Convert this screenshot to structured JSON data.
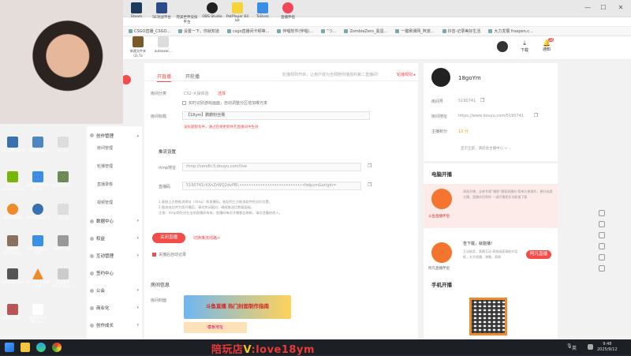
{
  "window": {
    "minimize_glyph": "—",
    "maximize_glyph": "☐",
    "close_glyph": "✕"
  },
  "desktop_top": [
    {
      "label": "Steam"
    },
    {
      "label": "5E对战平台"
    },
    {
      "label": "完美世界竞技平台"
    },
    {
      "label": "OBS Studio"
    },
    {
      "label": "PotPlayer 64 bit"
    },
    {
      "label": "ToDesk"
    },
    {
      "label": "直播伴侣"
    }
  ],
  "bookmarks": [
    "CSGO直播_CSGO...",
    "设置一下，你就知道",
    "csgo直播间卡顿等...",
    "伴唱软件(伴唱)...",
    "”つ...",
    "ZombieZero_黑蛋...",
    "一键刷课网_阿波...",
    "抖音-记录美好生活",
    "大力发展 fraspen.c..."
  ],
  "header": {
    "download_label": "下载",
    "notify_label": "通知",
    "notify_badge": "38"
  },
  "sidebar": {
    "groups": [
      {
        "label": "创作管理",
        "items": [
          "房间管理",
          "轮播管理",
          "直播录像",
          "视频管理"
        ]
      },
      {
        "label": "数据中心",
        "items": []
      },
      {
        "label": "权益",
        "items": []
      },
      {
        "label": "互动管理",
        "items": []
      },
      {
        "label": "签约中心",
        "items": []
      },
      {
        "label": "公会",
        "items": []
      },
      {
        "label": "商业化",
        "items": []
      },
      {
        "label": "创作成长",
        "items": []
      }
    ]
  },
  "main": {
    "tabs": [
      "开直播",
      "开轮播"
    ],
    "notice_text": "轮播规则开启，让用户成为全网陪你播放的第二直播间!",
    "notice_link": "轮播规则 ▸",
    "category_label": "房间分类",
    "category_value": "CS2-大操体验",
    "category_link": "选择",
    "auto_switch_label": "实时识别游戏画面，自动调整分区增加曝光率",
    "title_label": "房间标题",
    "title_value": "【18ym】鹏鹏粉丝赛",
    "title_warning": "该标题暂有中，通过后将更新并在直播间中生效",
    "stream_section": "推流设置",
    "rtmp_label": "rtmp地址",
    "rtmp_value": "rtmp://sendtc3.douyu.com/live",
    "key_label": "直播码",
    "key_value": "5190741rXXnZrWQ2dvPBl.••••••••••••••••••••••••••••fwlpcm&origin=",
    "help_lines": [
      "1.复制上方数推流地址（rtmp）和直播码，粘贴到三方推流软件的对应位置。",
      "2.推流成功并为您开播后，请勿关闭窗口，确保推流后数据面板。",
      "注意：rtmp地址仅在当前直播间有效，直播码每次开播都会刷新，请勿泄露给他人。"
    ],
    "close_button": "关闭直播",
    "close_link": "切换推流线路>",
    "nosave_label": "关播后自动记录",
    "room_info_title": "房间信息",
    "cover_label": "房间封面",
    "cover_banner_text": "斗鱼直播 热门封面制作指南",
    "cover_sub_text": "模板地址"
  },
  "profile": {
    "name": "18goYm",
    "room_id_label": "房间号",
    "room_id": "5190741",
    "room_url_label": "房间地址",
    "room_url": "https://www.douyu.com/5190741",
    "points_label": "主播积分",
    "points": "12 分",
    "more_link": "显示全部，请前往主播中心 >"
  },
  "pc_stream": {
    "title": "电脑开播",
    "app1_name": "斗鱼直播伴侣",
    "app1_desc": "高效开播，全新专属“爆款”模版直播时 简单方便操作，更好成就主播。直播伴侣帮你 一键开播更多功能请下载",
    "app2_name": "阿凡直播伴侣",
    "app2_title": "告下载，就能播！",
    "app2_desc": "互动抽奖、表情互动 高效画面调取对话框，文字直播，弹幕，表情",
    "app2_button": "阿凡直播"
  },
  "mobile_stream": {
    "title": "手机开播"
  },
  "desktop_left": [
    {
      "label": "TeamSpeak 3"
    },
    {
      "label": "Wireshark"
    },
    {
      "label": "cs.cfg"
    },
    {
      "label": "GeForce Experience"
    },
    {
      "label": "PWC平衡文件夹.lnk"
    },
    {
      "label": "g161-b-20..."
    },
    {
      "label": "雷神加速器"
    },
    {
      "label": "TeamSpeak 3"
    },
    {
      "label": "c2.cfg"
    },
    {
      "label": "QQ图片20250813..."
    },
    {
      "label": "PGL Astana 2025"
    },
    {
      "label": "9月02.mp4"
    },
    {
      "label": "8月14日.mp4"
    },
    {
      "label": "vlc.exe - 快捷方式"
    },
    {
      "label": "微信图片20250801..."
    },
    {
      "label": "g161-n-20..."
    },
    {
      "label": "新建文本文档.docx"
    }
  ],
  "desktop_file_icons": [
    {
      "label": "新建文件夹 (3).7z"
    },
    {
      "label": "autoexec..."
    }
  ],
  "taskbar": {
    "banner_prefix": "陪玩店",
    "banner_v": "V",
    "banner_suffix": ":love18ym",
    "tray_lang": "英",
    "time": "9:48",
    "date": "2025/9/12"
  },
  "colors": {
    "accent": "#f34c49",
    "banner_red": "#e83a39",
    "banner_yellow": "#f7c92a",
    "taskbar": "#1c1f24",
    "desktop_bg": "#2a2d33"
  }
}
